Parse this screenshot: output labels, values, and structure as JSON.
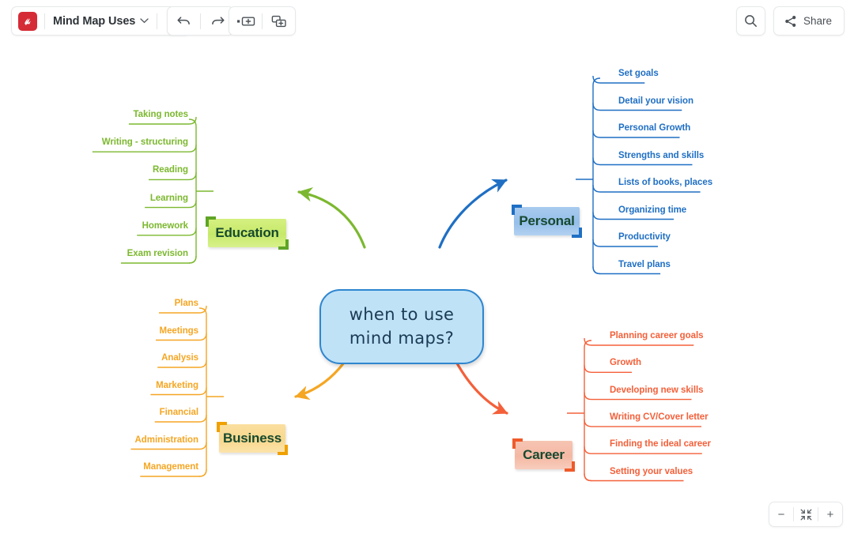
{
  "toolbar": {
    "logo_icon": "mindmeister-logo-icon",
    "doc_title": "Mind Map Uses",
    "caret_icon": "chevron-down-icon",
    "menu_icon": "hamburger-menu-icon",
    "undo_icon": "undo-arrow-icon",
    "redo_icon": "redo-arrow-icon",
    "add_sibling_icon": "add-sibling-topic-icon",
    "add_subtopic_icon": "add-subtopic-icon",
    "search_icon": "search-icon",
    "share_icon": "share-icon",
    "share_label": "Share"
  },
  "zoom_controls": {
    "zoom_out_label": "−",
    "fit_icon": "fit-to-screen-icon",
    "zoom_in_label": "+"
  },
  "map": {
    "center": {
      "line1": "when to use",
      "line2": "mind maps?",
      "fill": "#bfe2f7",
      "stroke": "#2e86d0"
    },
    "branches": [
      {
        "id": "education",
        "label": "Education",
        "color": "#7cb82f",
        "accent": "#5fa526",
        "fill": "#c6e96a",
        "side": "left",
        "children": [
          "Taking notes",
          "Writing - structuring",
          "Reading",
          "Learning",
          "Homework",
          "Exam revision"
        ]
      },
      {
        "id": "personal",
        "label": "Personal",
        "color": "#1f6fc4",
        "accent": "#1f6fc4",
        "fill": "#95bfea",
        "side": "right",
        "children": [
          "Set goals",
          "Detail your vision",
          "Personal Growth",
          "Strengths and skills",
          "Lists of books, places",
          "Organizing time",
          "Productivity",
          "Travel plans"
        ]
      },
      {
        "id": "business",
        "label": "Business",
        "color": "#f5a623",
        "accent": "#f0a000",
        "fill": "#f8d88d",
        "side": "left",
        "children": [
          "Plans",
          "Meetings",
          "Analysis",
          "Marketing",
          "Financial",
          "Administration",
          "Management"
        ]
      },
      {
        "id": "career",
        "label": "Career",
        "color": "#f4603a",
        "accent": "#ef5a2a",
        "fill": "#f4b8a3",
        "side": "right",
        "children": [
          "Planning career goals",
          "Growth",
          "Developing new skills",
          "Writing CV/Cover letter",
          "Finding the ideal career",
          "Setting  your values"
        ]
      }
    ]
  }
}
